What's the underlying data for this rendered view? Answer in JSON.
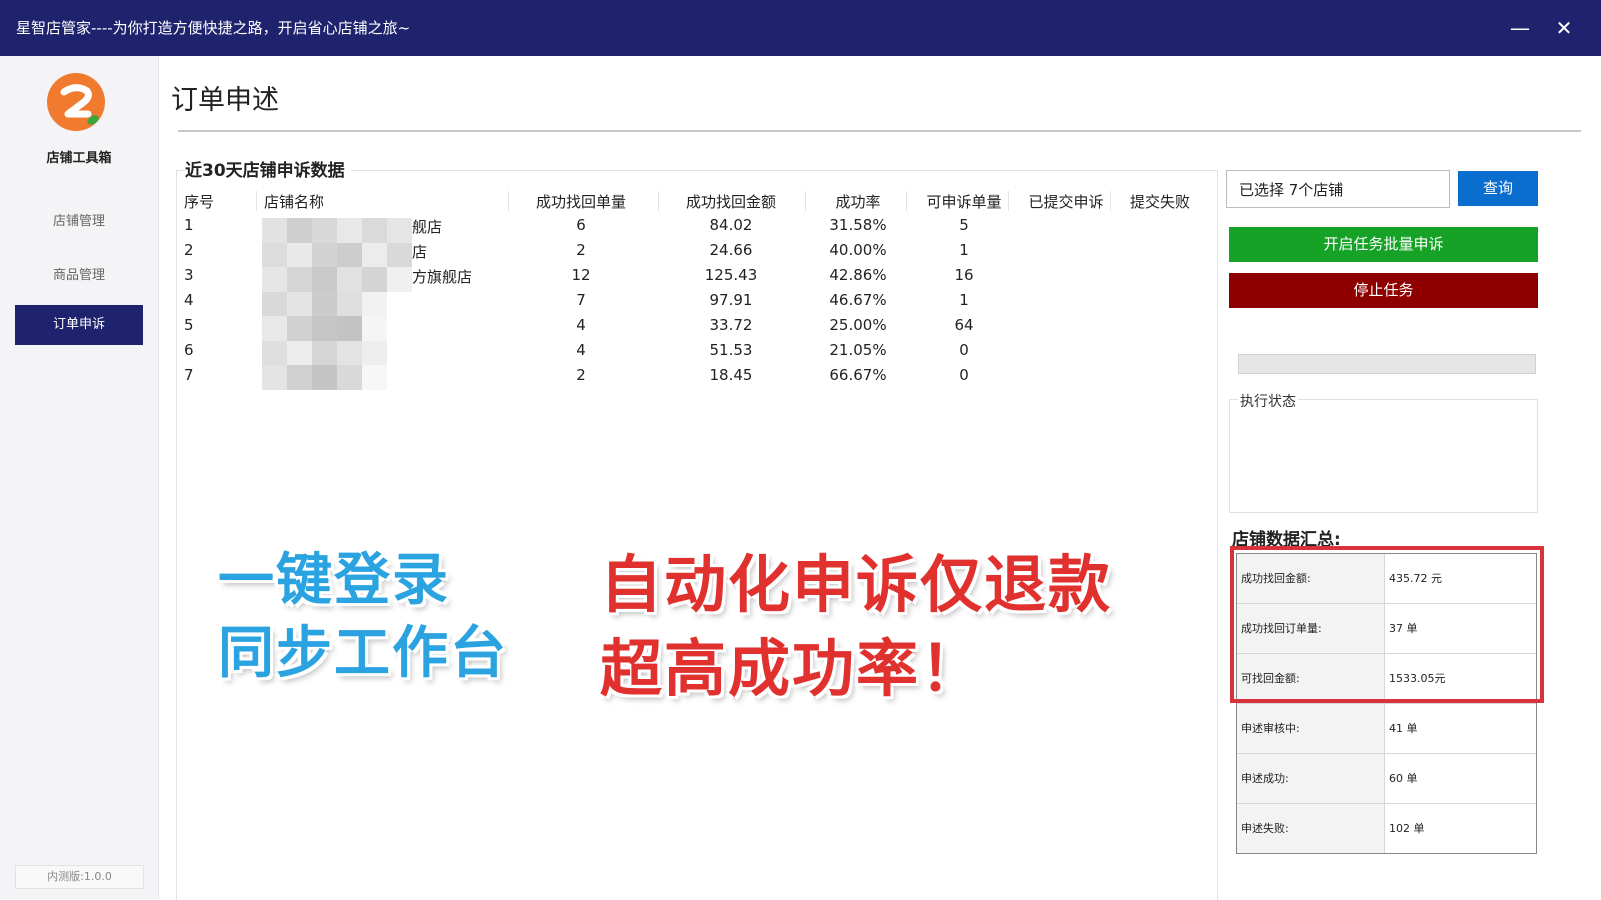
{
  "window": {
    "title": "星智店管家----为你打造方便快捷之路，开启省心店铺之旅~",
    "minimize_label": "—",
    "close_label": "✕"
  },
  "sidebar": {
    "logo_icon": "logo-icon",
    "app_name": "店铺工具箱",
    "items": [
      {
        "label": "店铺管理",
        "active": false
      },
      {
        "label": "商品管理",
        "active": false
      },
      {
        "label": "订单申诉",
        "active": true
      }
    ],
    "version": "内测版:1.0.0"
  },
  "main": {
    "page_title": "订单申述",
    "panel_title": "近30天店铺申诉数据",
    "columns": [
      "序号",
      "店铺名称",
      "成功找回单量",
      "成功找回金额",
      "成功率",
      "可申诉单量",
      "已提交申诉",
      "提交失败"
    ],
    "rows": [
      {
        "index": "1",
        "store_name_visible": "舰店",
        "recovered_orders": "6",
        "recovered_amount": "84.02",
        "success_rate": "31.58%",
        "appealable": "5",
        "submitted": "",
        "failed": ""
      },
      {
        "index": "2",
        "store_name_visible": "店",
        "recovered_orders": "2",
        "recovered_amount": "24.66",
        "success_rate": "40.00%",
        "appealable": "1",
        "submitted": "",
        "failed": ""
      },
      {
        "index": "3",
        "store_name_visible": "方旗舰店",
        "recovered_orders": "12",
        "recovered_amount": "125.43",
        "success_rate": "42.86%",
        "appealable": "16",
        "submitted": "",
        "failed": ""
      },
      {
        "index": "4",
        "store_name_visible": "",
        "recovered_orders": "7",
        "recovered_amount": "97.91",
        "success_rate": "46.67%",
        "appealable": "1",
        "submitted": "",
        "failed": ""
      },
      {
        "index": "5",
        "store_name_visible": "",
        "recovered_orders": "4",
        "recovered_amount": "33.72",
        "success_rate": "25.00%",
        "appealable": "64",
        "submitted": "",
        "failed": ""
      },
      {
        "index": "6",
        "store_name_visible": "",
        "recovered_orders": "4",
        "recovered_amount": "51.53",
        "success_rate": "21.05%",
        "appealable": "0",
        "submitted": "",
        "failed": ""
      },
      {
        "index": "7",
        "store_name_visible": "",
        "recovered_orders": "2",
        "recovered_amount": "18.45",
        "success_rate": "66.67%",
        "appealable": "0",
        "submitted": "",
        "failed": ""
      }
    ]
  },
  "promo": {
    "line1": "一键登录",
    "line2": "同步工作台",
    "line3": "自动化申诉仅退款",
    "line4": "超高成功率！",
    "blue_color": "#2aa3e0",
    "red_color": "#e0312e"
  },
  "right_panel": {
    "store_select": "已选择 7个店铺",
    "query_label": "查询",
    "start_label": "开启任务批量申诉",
    "stop_label": "停止任务",
    "progress": 0,
    "status_label": "执行状态",
    "summary_title": "店铺数据汇总:",
    "summary": [
      {
        "label": "成功找回金额:",
        "value": "435.72 元"
      },
      {
        "label": "成功找回订单量:",
        "value": "37 单"
      },
      {
        "label": "可找回金额:",
        "value": "1533.05元"
      },
      {
        "label": "申述审核中:",
        "value": "41 单"
      },
      {
        "label": "申述成功:",
        "value": "60 单"
      },
      {
        "label": "申述失败:",
        "value": "102 单"
      }
    ]
  },
  "colors": {
    "titlebar": "#1f236e",
    "query_button": "#0a6ecf",
    "start_button": "#16a226",
    "stop_button": "#8e0000",
    "highlight": "#d8323a"
  }
}
